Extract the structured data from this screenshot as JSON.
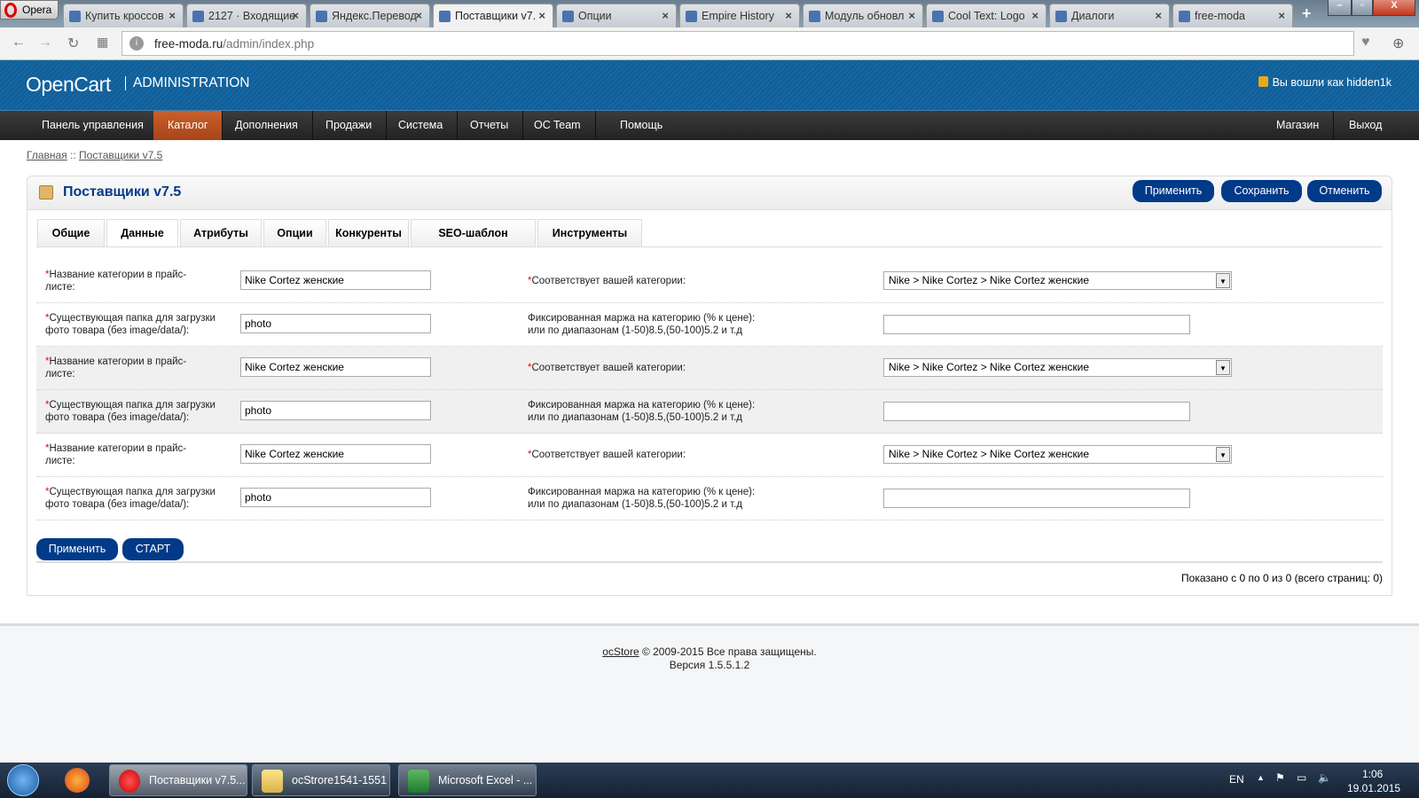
{
  "browser": {
    "opera_label": "Opera",
    "tabs": [
      {
        "title": "Купить кроссов",
        "active": false,
        "icon": "shoe-icon"
      },
      {
        "title": "2127 · Входящие",
        "active": false,
        "icon": "mail-icon"
      },
      {
        "title": "Яндекс.Перевод",
        "active": false,
        "icon": "translate-icon"
      },
      {
        "title": "Поставщики v7.",
        "active": true,
        "icon": "page-icon"
      },
      {
        "title": "Опции",
        "active": false,
        "icon": "page-icon"
      },
      {
        "title": "Empire History",
        "active": false,
        "icon": "vk-icon"
      },
      {
        "title": "Модуль обновл",
        "active": false,
        "icon": "module-icon"
      },
      {
        "title": "Cool Text: Logo",
        "active": false,
        "icon": "cooltext-icon"
      },
      {
        "title": "Диалоги",
        "active": false,
        "icon": "chat-icon"
      },
      {
        "title": "free-moda",
        "active": false,
        "icon": "f-icon"
      }
    ],
    "url_domain": "free-moda.ru",
    "url_path": "/admin/index.php"
  },
  "header": {
    "logo": "OpenCart",
    "logo_sub": "ADMINISTRATION",
    "logged_in": "Вы вошли как hidden1k"
  },
  "menu": {
    "items": [
      "Панель управления",
      "Каталог",
      "Дополнения",
      "Продажи",
      "Система",
      "Отчеты",
      "OC Team",
      "Помощь"
    ],
    "active": "Каталог",
    "right": [
      "Магазин",
      "Выход"
    ]
  },
  "breadcrumb": {
    "home": "Главная",
    "sep": " :: ",
    "current": "Поставщики v7.5"
  },
  "panel": {
    "title": "Поставщики v7.5",
    "buttons": {
      "apply": "Применить",
      "save": "Сохранить",
      "cancel": "Отменить"
    },
    "tabs": [
      "Общие",
      "Данные",
      "Атрибуты",
      "Опции",
      "Конкуренты",
      "SEO-шаблон",
      "Инструменты"
    ],
    "active_tab": "Данные",
    "labels": {
      "cat_name_1": "Название категории в прайс-",
      "cat_name_2": "листе:",
      "folder_1": "Существующая папка для загрузки",
      "folder_2": "фото товара (без image/data/):",
      "match": "Соответствует вашей категории:",
      "margin_1": "Фиксированная маржа на категорию (% к цене):",
      "margin_2": "или по диапазонам (1-50)8.5,(50-100)5.2 и т.д"
    },
    "groups": [
      {
        "cat_name": "Nike Cortez женские",
        "folder": "photo",
        "match": "Nike > Nike Cortez > Nike Cortez женские",
        "margin": ""
      },
      {
        "cat_name": "Nike Cortez женские",
        "folder": "photo",
        "match": "Nike > Nike Cortez > Nike Cortez женские",
        "margin": ""
      },
      {
        "cat_name": "Nike Cortez женские",
        "folder": "photo",
        "match": "Nike > Nike Cortez > Nike Cortez женские",
        "margin": ""
      }
    ],
    "bottom_buttons": {
      "apply": "Применить",
      "start": "СТАРТ"
    },
    "pager": "Показано с 0 по 0 из 0 (всего страниц: 0)"
  },
  "footer": {
    "link": "ocStore",
    "copyright": " © 2009-2015 Все права защищены.",
    "version": "Версия 1.5.5.1.2"
  },
  "taskbar": {
    "items": [
      "Поставщики v7.5...",
      "ocStrore1541-1551",
      "Microsoft Excel - ..."
    ],
    "lang": "EN",
    "time": "1:06",
    "date": "19.01.2015"
  },
  "colors": {
    "brand_blue": "#003a88",
    "header_blue": "#1468a5",
    "menu_active": "#c9602a",
    "required": "#ff0000"
  }
}
